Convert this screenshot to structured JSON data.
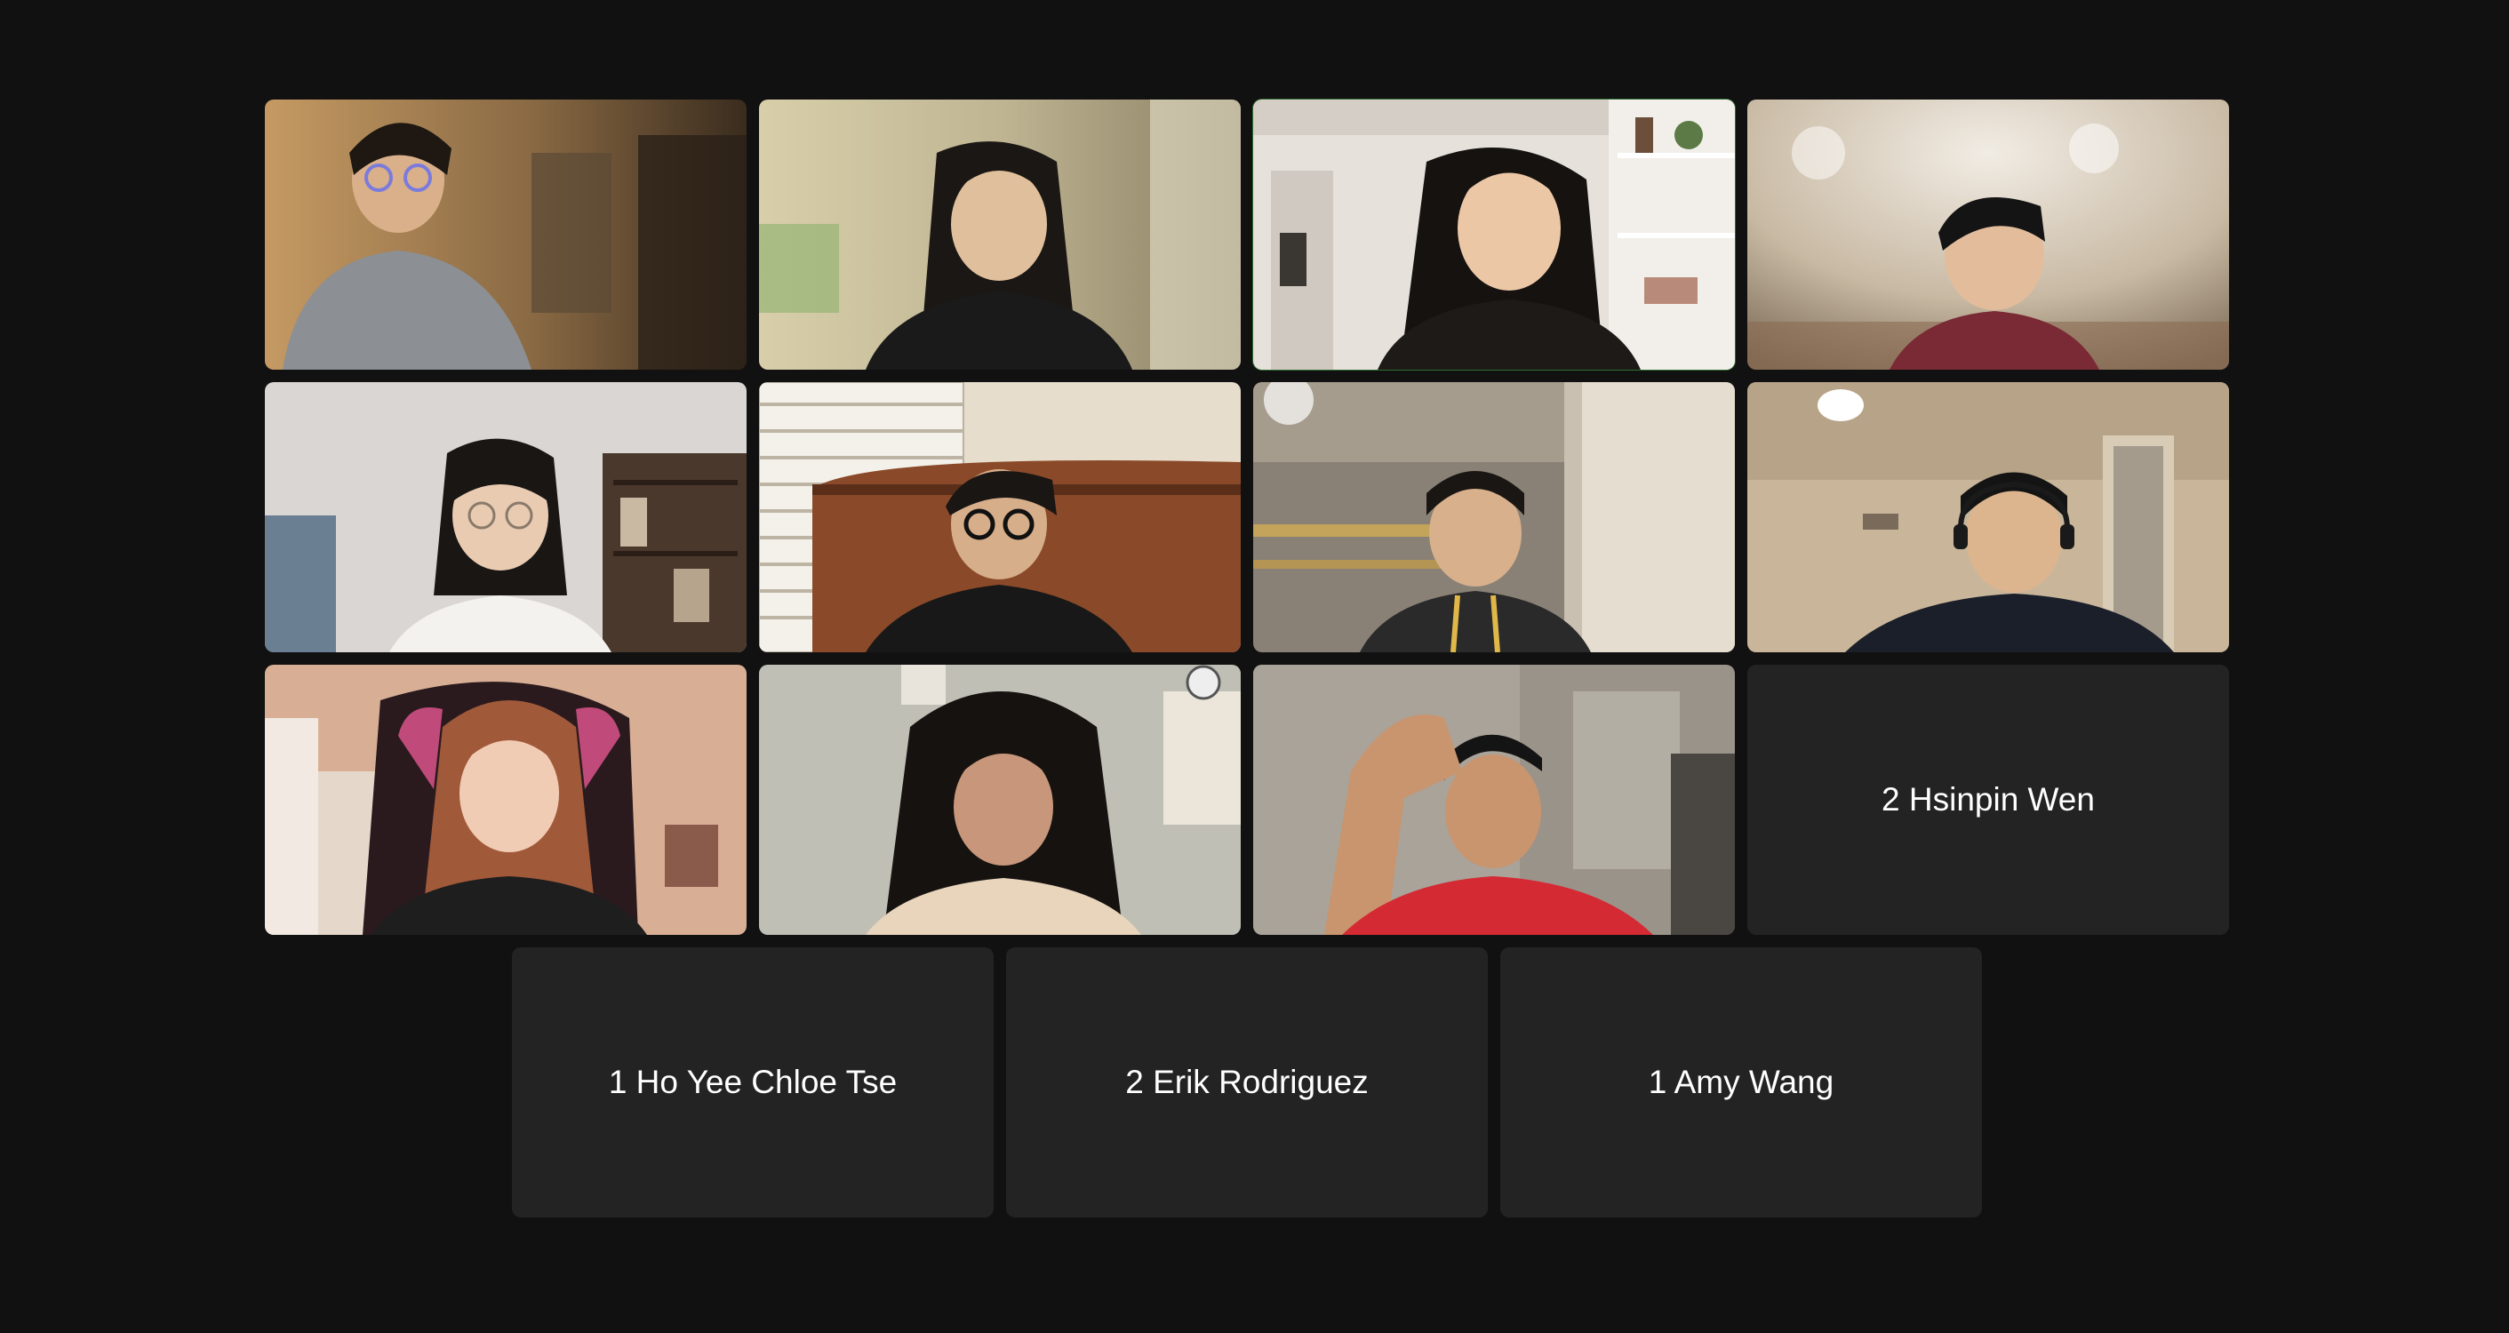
{
  "meeting": {
    "view": "gallery",
    "active_speaker_border_color": "#5fd160",
    "background_color": "#111111",
    "tile_color": "#232323"
  },
  "video_tiles": [
    {
      "label": "participant-video-1",
      "scene": "warm living room, grey t-shirt, round glasses"
    },
    {
      "label": "participant-video-2",
      "scene": "blurred background, black hoodie"
    },
    {
      "label": "participant-video-3",
      "scene": "bright room with shelves",
      "active_speaker": true
    },
    {
      "label": "participant-video-4",
      "scene": "blurred room, red top"
    },
    {
      "label": "participant-video-5",
      "scene": "bedroom with bookshelf, glasses"
    },
    {
      "label": "participant-video-6",
      "scene": "window blinds, wooden headboard, glasses"
    },
    {
      "label": "participant-video-7",
      "scene": "bunk bed, curtain, lanyard"
    },
    {
      "label": "participant-video-8",
      "scene": "ceiling light, headphones"
    },
    {
      "label": "participant-video-9",
      "scene": "gaming chair, pink-lit room"
    },
    {
      "label": "participant-video-10",
      "scene": "wall poster, curly hair"
    },
    {
      "label": "participant-video-11",
      "scene": "hand on head, red t-shirt"
    }
  ],
  "name_tiles": [
    {
      "name": "2 Hsinpin Wen"
    },
    {
      "name": "1 Ho Yee Chloe Tse"
    },
    {
      "name": "2 Erik Rodriguez"
    },
    {
      "name": "1 Amy Wang"
    }
  ]
}
